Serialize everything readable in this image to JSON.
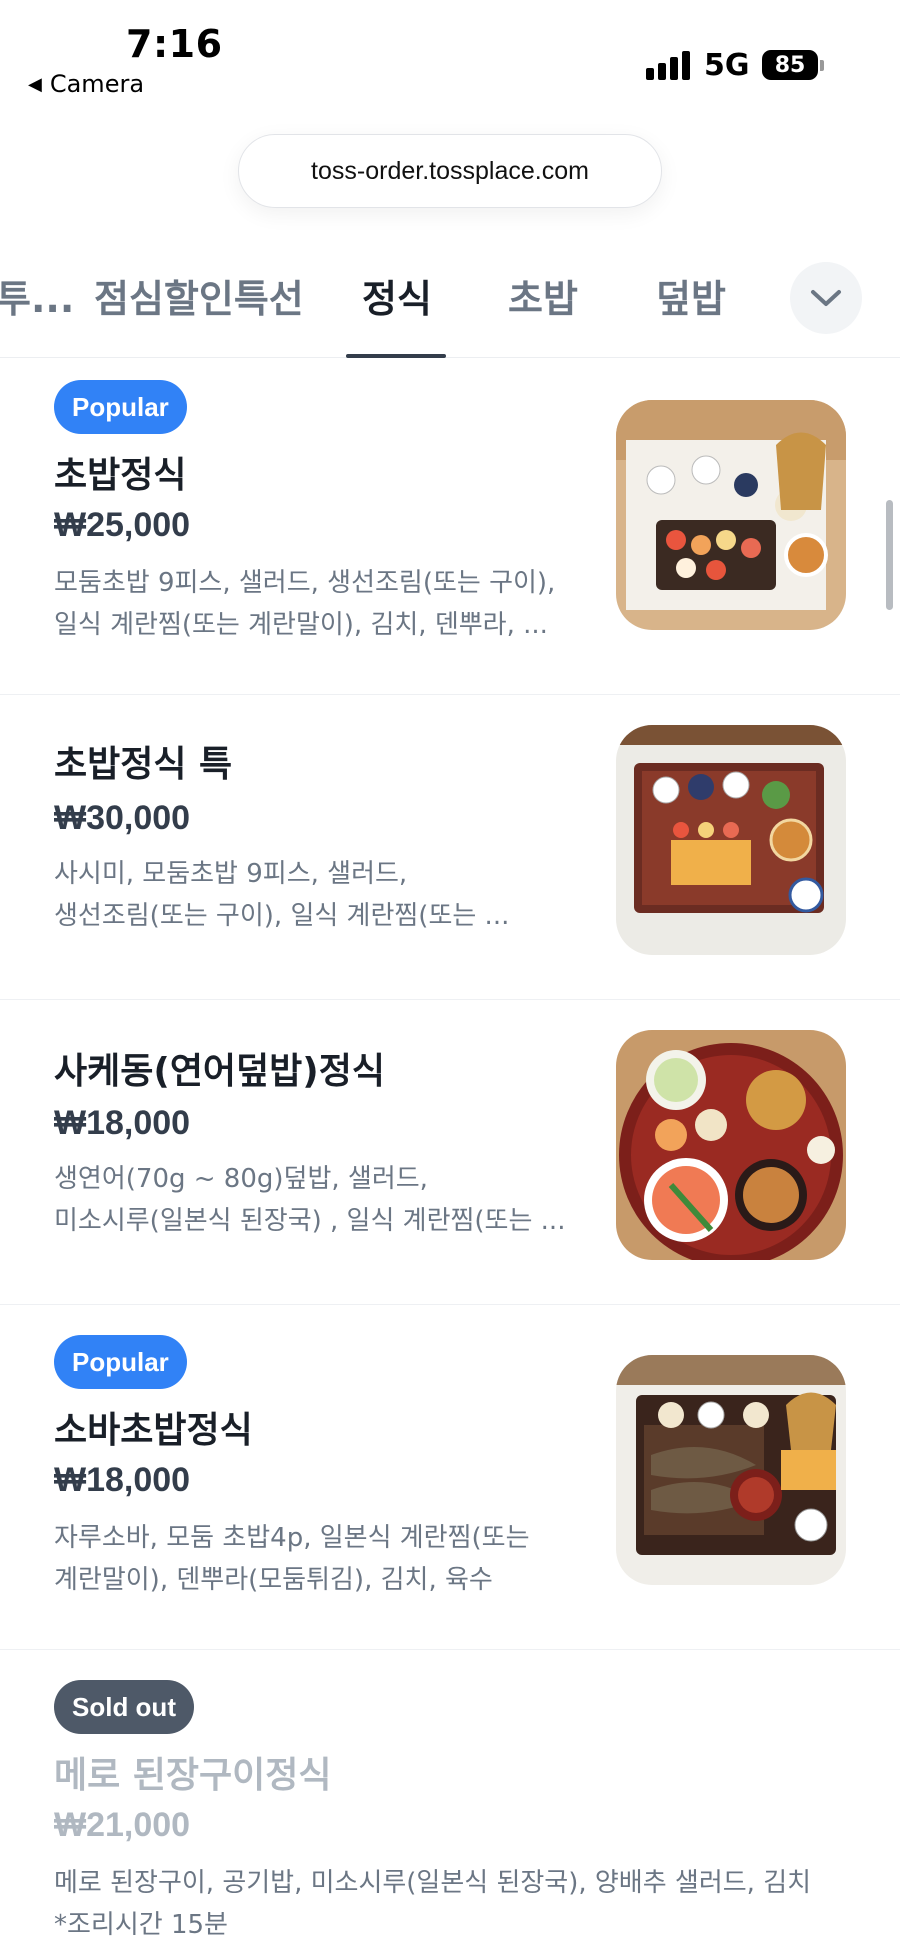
{
  "status_bar": {
    "time": "7:16",
    "back_app": "Camera",
    "network": "5G",
    "battery": "85"
  },
  "browser": {
    "url": "toss-order.tossplace.com"
  },
  "categories": {
    "tabs": [
      {
        "label": "투..."
      },
      {
        "label": "점심할인특선"
      },
      {
        "label": "정식"
      },
      {
        "label": "초밥"
      },
      {
        "label": "덮밥"
      }
    ],
    "active_index": 2
  },
  "menu": {
    "items": [
      {
        "badge": "Popular",
        "name": "초밥정식",
        "price": "₩25,000",
        "desc_lines": [
          "모둠초밥 9피스, 샐러드, 생선조림(또는 구이),",
          "일식 계란찜(또는 계란말이), 김치, 덴뿌라, ..."
        ]
      },
      {
        "badge": "",
        "name": "초밥정식 특",
        "price": "₩30,000",
        "desc_lines": [
          "사시미, 모둠초밥 9피스, 샐러드,",
          "생선조림(또는 구이), 일식 계란찜(또는 ..."
        ]
      },
      {
        "badge": "",
        "name": "사케동(연어덮밥)정식",
        "price": "₩18,000",
        "desc_lines": [
          "생연어(70g ~ 80g)덮밥, 샐러드,",
          "미소시루(일본식 된장국) , 일식 계란찜(또는 ..."
        ]
      },
      {
        "badge": "Popular",
        "name": "소바초밥정식",
        "price": "₩18,000",
        "desc_lines": [
          "자루소바, 모둠 초밥4p, 일본식 계란찜(또는",
          "계란말이), 덴뿌라(모둠튀김), 김치, 육수"
        ]
      },
      {
        "badge": "Sold out",
        "name": "메로 된장구이정식",
        "price": "₩21,000",
        "desc_lines": [
          "메로 된장구이, 공기밥, 미소시루(일본식 된장국), 양배추 샐러드, 김치",
          "*조리시간 15분"
        ]
      }
    ]
  },
  "colors": {
    "popular_badge": "#3182f6",
    "soldout_badge": "#4e5968",
    "active_tab_indicator": "#333d4b"
  }
}
